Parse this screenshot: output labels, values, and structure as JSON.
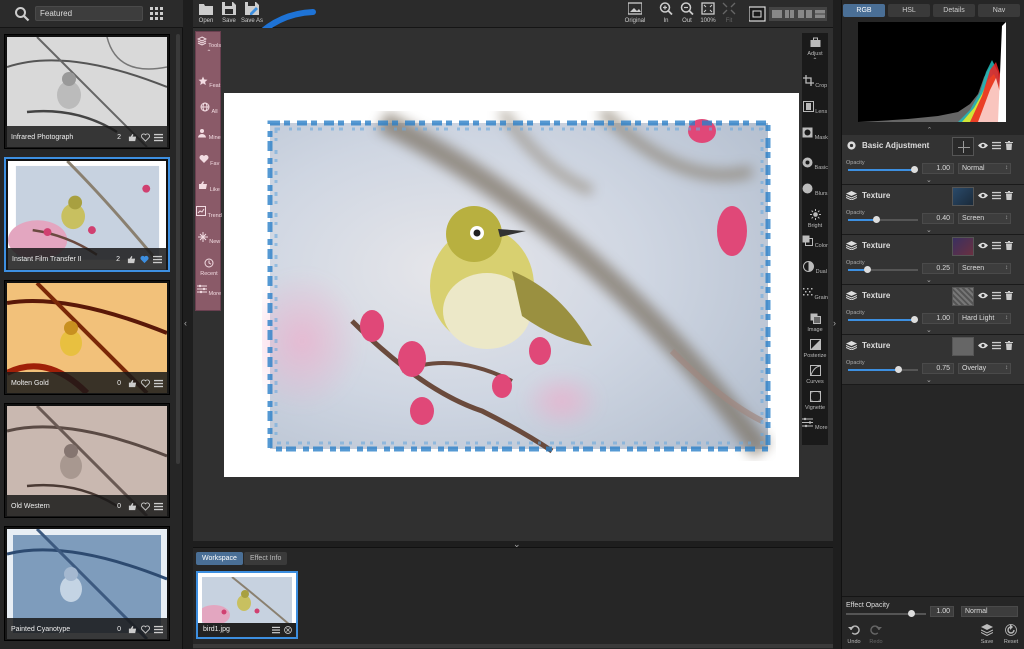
{
  "left_panel": {
    "search_value": "Featured",
    "presets": [
      {
        "name": "Infrared Photograph",
        "likes": "2",
        "selected": false
      },
      {
        "name": "Instant Film Transfer II",
        "likes": "2",
        "selected": true
      },
      {
        "name": "Molten Gold",
        "likes": "0",
        "selected": false
      },
      {
        "name": "Old Western",
        "likes": "0",
        "selected": false
      },
      {
        "name": "Painted Cyanotype",
        "likes": "0",
        "selected": false
      }
    ]
  },
  "toolbar": {
    "open": "Open",
    "save": "Save",
    "save_as": "Save As",
    "original": "Original",
    "zoom_in": "In",
    "zoom_out": "Out",
    "zoom_100": "100%",
    "fit": "Fit"
  },
  "tools_strip": {
    "tools": "Tools",
    "feat": "Feat",
    "all": "All",
    "mine": "Mine",
    "fav": "Fav",
    "like": "Like",
    "trend": "Trend",
    "new": "New",
    "recent": "Recent",
    "more": "More"
  },
  "right_strip": {
    "adjust": "Adjust",
    "crop": "Crop",
    "lens": "Lens",
    "mask": "Mask",
    "basic": "Basic",
    "blurs": "Blurs",
    "bright": "Bright",
    "color": "Color",
    "dual": "Dual",
    "grain": "Grain",
    "image": "Image",
    "posterize": "Posterize",
    "curves": "Curves",
    "vignette": "Vignette",
    "more": "More"
  },
  "workspace": {
    "tab_workspace": "Workspace",
    "tab_effect_info": "Effect Info",
    "file_name": "bird1.jpg"
  },
  "right_panel": {
    "tabs": [
      "RGB",
      "HSL",
      "Details",
      "Nav"
    ],
    "opacity_label": "Opacity",
    "layers": [
      {
        "title": "Basic Adjustment",
        "opacity": "1.00",
        "opacity_frac": 1.0,
        "blend": "Normal"
      },
      {
        "title": "Texture",
        "opacity": "0.40",
        "opacity_frac": 0.4,
        "blend": "Screen"
      },
      {
        "title": "Texture",
        "opacity": "0.25",
        "opacity_frac": 0.25,
        "blend": "Screen"
      },
      {
        "title": "Texture",
        "opacity": "1.00",
        "opacity_frac": 1.0,
        "blend": "Hard Light"
      },
      {
        "title": "Texture",
        "opacity": "0.75",
        "opacity_frac": 0.75,
        "blend": "Overlay"
      }
    ],
    "effect_opacity_label": "Effect Opacity",
    "effect_opacity": "1.00",
    "effect_blend": "Normal",
    "undo": "Undo",
    "redo": "Redo",
    "save": "Save",
    "reset": "Reset"
  }
}
